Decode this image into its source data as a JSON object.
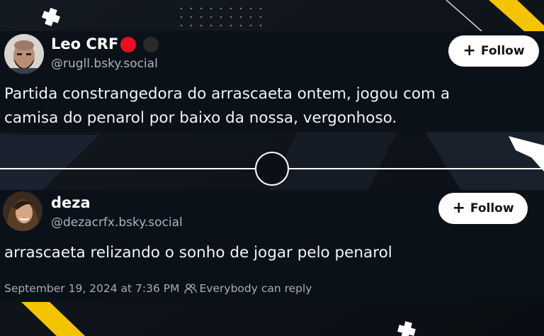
{
  "posts": [
    {
      "display_name": "Leo CRF",
      "handle": "@rugll.bsky.social",
      "follow_label": "Follow",
      "text_lines": [
        "Partida constrangedora do arrascaeta ontem, jogou com a",
        "camisa do penarol por baixo da nossa, vergonhoso."
      ],
      "badges": [
        "red-circle",
        "black-circle"
      ]
    },
    {
      "display_name": "deza",
      "handle": "@dezacrfx.bsky.social",
      "follow_label": "Follow",
      "text_lines": [
        "arrascaeta relizando o sonho de jogar pelo penarol"
      ],
      "timestamp": "September 19, 2024 at 7:36 PM",
      "reply_setting": "Everybody can reply"
    }
  ],
  "colors": {
    "accent_yellow": "#f5c400",
    "badge_red": "#e8101e",
    "badge_black": "#2a2a2a"
  }
}
